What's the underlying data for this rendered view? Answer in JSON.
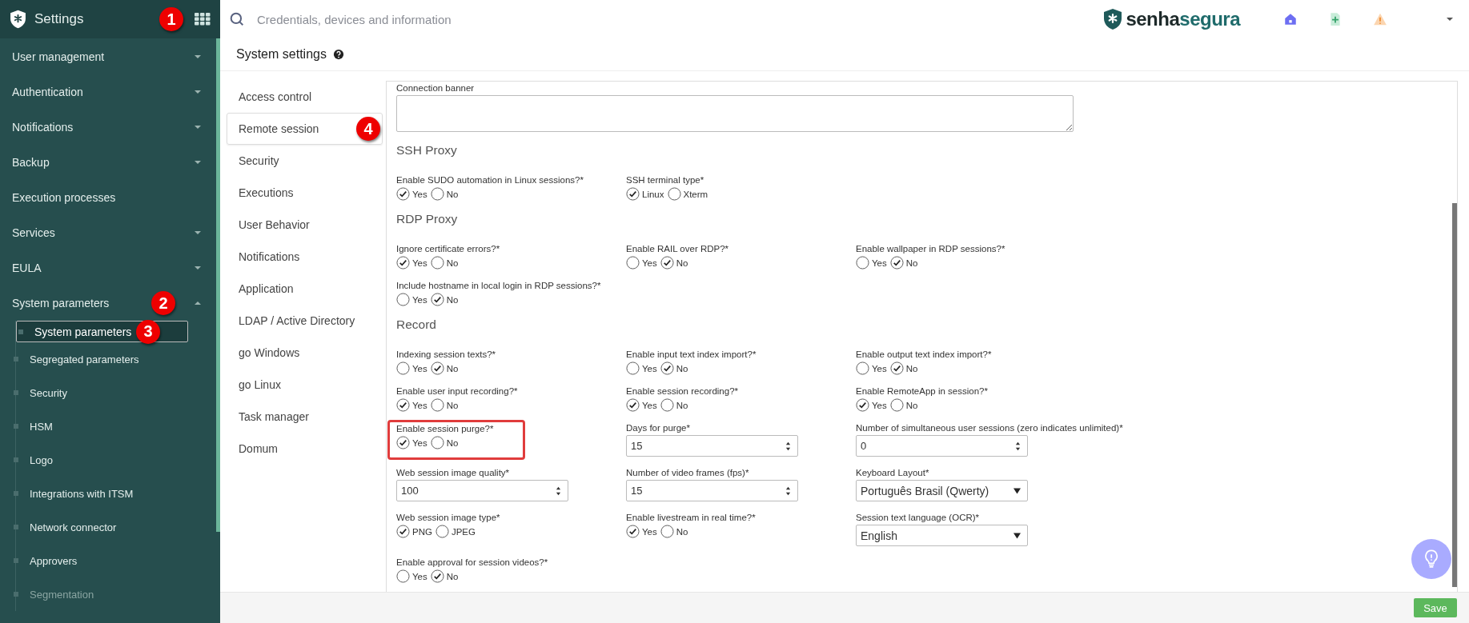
{
  "sidebar": {
    "title": "Settings",
    "badge": "1",
    "items": [
      {
        "label": "User management",
        "kind": "group",
        "expanded": false
      },
      {
        "label": "Authentication",
        "kind": "group",
        "expanded": false
      },
      {
        "label": "Notifications",
        "kind": "group",
        "expanded": false
      },
      {
        "label": "Backup",
        "kind": "group",
        "expanded": false
      },
      {
        "label": "Execution processes",
        "kind": "link"
      },
      {
        "label": "Services",
        "kind": "group",
        "expanded": false
      },
      {
        "label": "EULA",
        "kind": "group",
        "expanded": false
      },
      {
        "label": "System parameters",
        "kind": "group",
        "expanded": true,
        "badge": "2",
        "children": [
          {
            "label": "System parameters",
            "selected": true,
            "badge": "3"
          },
          {
            "label": "Segregated parameters",
            "selected": false
          },
          {
            "label": "Security",
            "selected": false
          },
          {
            "label": "HSM",
            "selected": false
          },
          {
            "label": "Logo",
            "selected": false
          },
          {
            "label": "Integrations with ITSM",
            "selected": false
          },
          {
            "label": "Network connector",
            "selected": false
          },
          {
            "label": "Approvers",
            "selected": false
          },
          {
            "label": "Segmentation",
            "selected": false
          }
        ]
      }
    ]
  },
  "topbar": {
    "search": {
      "placeholder": "Credentials, devices and information"
    },
    "logo": {
      "part_1": "senha",
      "part_2": "segura"
    }
  },
  "page_title": "System settings",
  "tabs": [
    {
      "label": "Access control",
      "selected": false
    },
    {
      "label": "Remote session",
      "selected": true,
      "badge": "4"
    },
    {
      "label": "Security",
      "selected": false
    },
    {
      "label": "Executions",
      "selected": false
    },
    {
      "label": "User Behavior",
      "selected": false
    },
    {
      "label": "Notifications",
      "selected": false
    },
    {
      "label": "Application",
      "selected": false
    },
    {
      "label": "LDAP / Active Directory",
      "selected": false
    },
    {
      "label": "go Windows",
      "selected": false
    },
    {
      "label": "go Linux",
      "selected": false
    },
    {
      "label": "Task manager",
      "selected": false
    },
    {
      "label": "Domum",
      "selected": false
    }
  ],
  "sections": [
    {
      "rows": [
        [
          {
            "kind": "textarea",
            "label": "Connection banner"
          }
        ]
      ]
    },
    {
      "title": "SSH Proxy",
      "rows": [
        [
          {
            "kind": "radio",
            "label": "Enable SUDO automation in Linux sessions?*",
            "options": [
              {
                "label": "Yes",
                "selected": true
              },
              {
                "label": "No",
                "selected": false
              }
            ]
          },
          {
            "kind": "radio",
            "label": "SSH terminal type*",
            "options": [
              {
                "label": "Linux",
                "selected": true
              },
              {
                "label": "Xterm",
                "selected": false
              }
            ]
          }
        ]
      ]
    },
    {
      "title": "RDP Proxy",
      "rows": [
        [
          {
            "kind": "radio",
            "label": "Ignore certificate errors?*",
            "options": [
              {
                "label": "Yes",
                "selected": true
              },
              {
                "label": "No",
                "selected": false
              }
            ]
          },
          {
            "kind": "radio",
            "label": "Enable RAIL over RDP?*",
            "options": [
              {
                "label": "Yes",
                "selected": false
              },
              {
                "label": "No",
                "selected": true
              }
            ]
          },
          {
            "kind": "radio",
            "label": "Enable wallpaper in RDP sessions?*",
            "options": [
              {
                "label": "Yes",
                "selected": false
              },
              {
                "label": "No",
                "selected": true
              }
            ]
          }
        ],
        [
          {
            "kind": "radio",
            "label": "Include hostname in local login in RDP sessions?*",
            "options": [
              {
                "label": "Yes",
                "selected": false
              },
              {
                "label": "No",
                "selected": true
              }
            ]
          }
        ]
      ]
    },
    {
      "title": "Record",
      "rows": [
        [
          {
            "kind": "radio",
            "label": "Indexing session texts?*",
            "options": [
              {
                "label": "Yes",
                "selected": false
              },
              {
                "label": "No",
                "selected": true
              }
            ]
          },
          {
            "kind": "radio",
            "label": "Enable input text index import?*",
            "options": [
              {
                "label": "Yes",
                "selected": false
              },
              {
                "label": "No",
                "selected": true
              }
            ]
          },
          {
            "kind": "radio",
            "label": "Enable output text index import?*",
            "options": [
              {
                "label": "Yes",
                "selected": false
              },
              {
                "label": "No",
                "selected": true
              }
            ]
          }
        ],
        [
          {
            "kind": "radio",
            "label": "Enable user input recording?*",
            "options": [
              {
                "label": "Yes",
                "selected": true
              },
              {
                "label": "No",
                "selected": false
              }
            ]
          },
          {
            "kind": "radio",
            "label": "Enable session recording?*",
            "options": [
              {
                "label": "Yes",
                "selected": true
              },
              {
                "label": "No",
                "selected": false
              }
            ]
          },
          {
            "kind": "radio",
            "label": "Enable RemoteApp in session?*",
            "options": [
              {
                "label": "Yes",
                "selected": true
              },
              {
                "label": "No",
                "selected": false
              }
            ]
          }
        ],
        [
          {
            "kind": "radio",
            "label": "Enable session purge?*",
            "highlighted": true,
            "options": [
              {
                "label": "Yes",
                "selected": true
              },
              {
                "label": "No",
                "selected": false
              }
            ]
          },
          {
            "kind": "number",
            "label": "Days for purge*",
            "value": "15"
          },
          {
            "kind": "number",
            "label": "Number of simultaneous user sessions (zero indicates unlimited)*",
            "value": "0"
          }
        ],
        [
          {
            "kind": "number",
            "label": "Web session image quality*",
            "value": "100"
          },
          {
            "kind": "number",
            "label": "Number of video frames (fps)*",
            "value": "15"
          },
          {
            "kind": "select",
            "label": "Keyboard Layout*",
            "value": "Português Brasil (Qwerty)"
          }
        ],
        [
          {
            "kind": "radio",
            "label": "Web session image type*",
            "options": [
              {
                "label": "PNG",
                "selected": true
              },
              {
                "label": "JPEG",
                "selected": false
              }
            ]
          },
          {
            "kind": "radio",
            "label": "Enable livestream in real time?*",
            "options": [
              {
                "label": "Yes",
                "selected": true
              },
              {
                "label": "No",
                "selected": false
              }
            ]
          },
          {
            "kind": "select",
            "label": "Session text language (OCR)*",
            "value": "English"
          }
        ],
        [
          {
            "kind": "radio",
            "label": "Enable approval for session videos?*",
            "options": [
              {
                "label": "Yes",
                "selected": false
              },
              {
                "label": "No",
                "selected": true
              }
            ]
          }
        ]
      ]
    }
  ],
  "save_button": "Save"
}
